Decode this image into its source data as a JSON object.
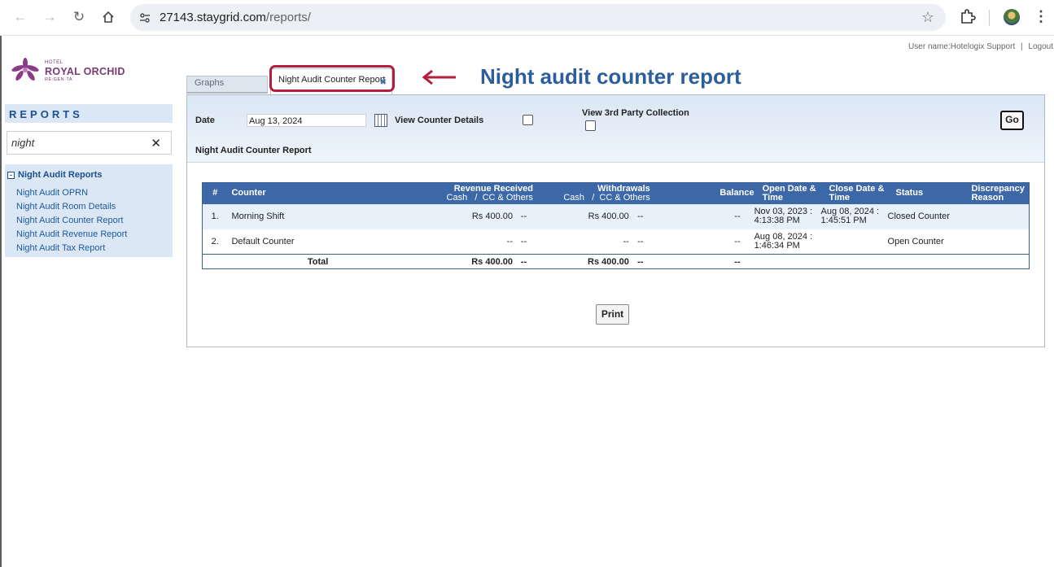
{
  "browser": {
    "url_host": "27143.staygrid.com",
    "url_path": "/reports/",
    "icons": [
      "back-icon",
      "forward-icon",
      "reload-icon",
      "home-icon",
      "site-settings-icon",
      "star-icon",
      "extensions-icon",
      "profile-avatar",
      "menu-icon"
    ]
  },
  "header": {
    "user_label": "User name:Hotelogix Support",
    "separator": "|",
    "logout": "Logout"
  },
  "logo": {
    "hotel": "HOTEL",
    "name": "ROYAL ORCHID",
    "sub": "RE:GEN·TA"
  },
  "sidebar": {
    "title": "REPORTS",
    "search_value": "night",
    "group_label": "Night Audit Reports",
    "items": [
      {
        "label": "Night Audit OPRN"
      },
      {
        "label": "Night Audit Room Details"
      },
      {
        "label": "Night Audit Counter Report"
      },
      {
        "label": "Night Audit Revenue Report"
      },
      {
        "label": "Night Audit Tax Report"
      }
    ]
  },
  "tabs": {
    "graphs": "Graphs",
    "active": "Night Audit Counter Report"
  },
  "annotation": {
    "text": "Night audit counter report",
    "color": "#2c5d9c",
    "ring_color": "#b21e3c"
  },
  "filters": {
    "date_label": "Date",
    "date_value": "Aug 13, 2024",
    "view_counter_details": "View Counter Details",
    "view_third_party": "View 3rd Party Collection",
    "go": "Go",
    "report_title": "Night Audit Counter Report"
  },
  "table": {
    "headers": {
      "num": "#",
      "counter": "Counter",
      "revenue": "Revenue Received",
      "withdrawals": "Withdrawals",
      "cash": "Cash",
      "slash": "/",
      "cc": "CC & Others",
      "balance": "Balance",
      "open_date_l1": "Open Date &",
      "open_date_l2": "Time",
      "close_date_l1": "Close Date &",
      "close_date_l2": "Time",
      "status": "Status",
      "discrepancy_l1": "Discrepancy",
      "discrepancy_l2": "Reason"
    },
    "rows": [
      {
        "num": "1.",
        "counter": "Morning Shift",
        "rev_cash": "Rs 400.00",
        "rev_cc": "--",
        "wd_cash": "Rs 400.00",
        "wd_cc": "--",
        "balance": "--",
        "open_l1": "Nov 03, 2023 :",
        "open_l2": "4:13:38 PM",
        "close_l1": "Aug 08, 2024 :",
        "close_l2": "1:45:51 PM",
        "status": "Closed Counter",
        "reason": ""
      },
      {
        "num": "2.",
        "counter": "Default Counter",
        "rev_cash": "--",
        "rev_cc": "--",
        "wd_cash": "--",
        "wd_cc": "--",
        "balance": "--",
        "open_l1": "Aug 08, 2024 :",
        "open_l2": "1:46:34 PM",
        "close_l1": "",
        "close_l2": "",
        "status": "Open Counter",
        "reason": ""
      }
    ],
    "total": {
      "label": "Total",
      "rev_cash": "Rs 400.00",
      "rev_cc": "--",
      "wd_cash": "Rs 400.00",
      "wd_cc": "--",
      "balance": "--"
    }
  },
  "print": "Print"
}
